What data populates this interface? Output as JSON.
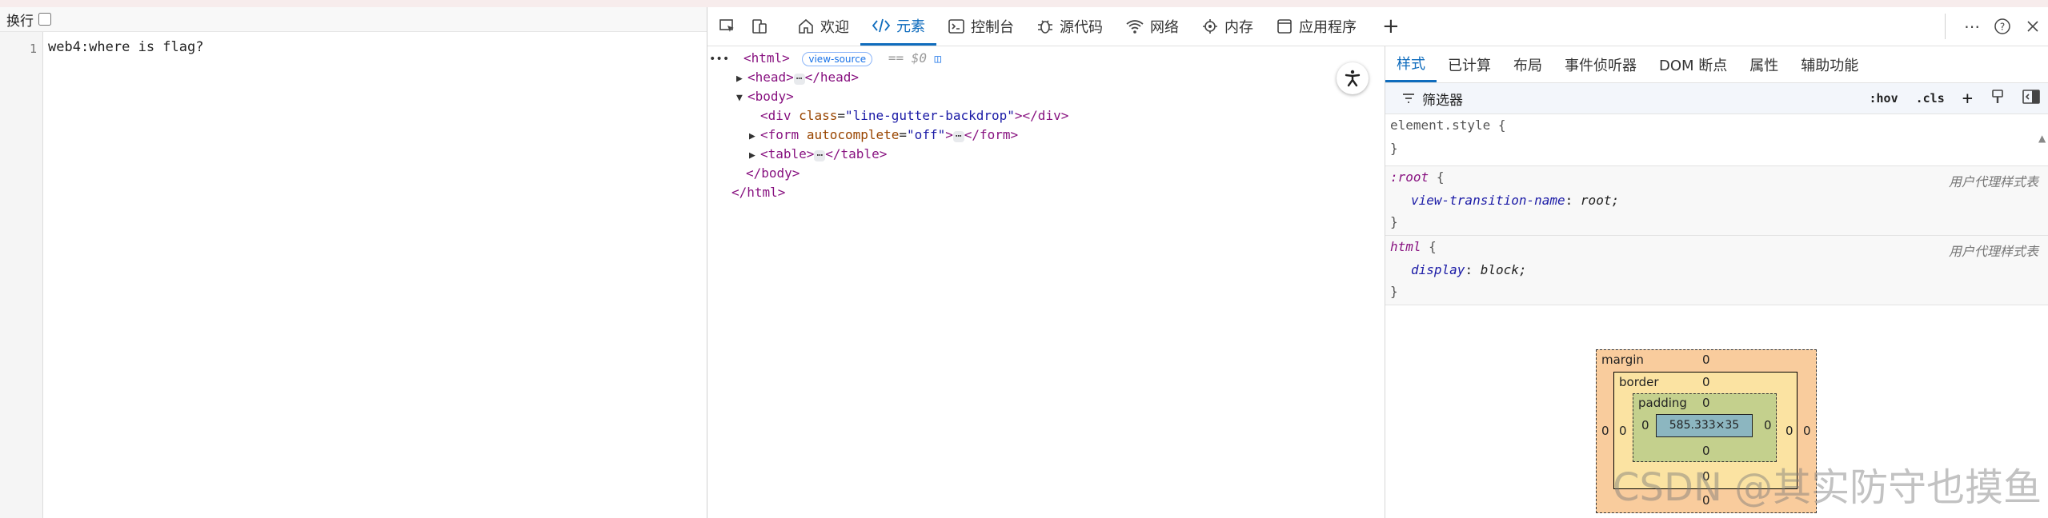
{
  "source": {
    "wrap_label": "换行",
    "line_number": "1",
    "line_text": "web4:where is flag?"
  },
  "devtools": {
    "tabs": [
      {
        "label": "欢迎",
        "icon": "home-icon"
      },
      {
        "label": "元素",
        "icon": "code-tags-icon"
      },
      {
        "label": "控制台",
        "icon": "console-icon"
      },
      {
        "label": "源代码",
        "icon": "bug-icon"
      },
      {
        "label": "网络",
        "icon": "wifi-icon"
      },
      {
        "label": "内存",
        "icon": "memory-icon"
      },
      {
        "label": "应用程序",
        "icon": "app-window-icon"
      }
    ],
    "active_tab": "元素",
    "add_tab_symbol": "+"
  },
  "dom": {
    "html_open": "<html>",
    "view_source_badge": "view-source",
    "dollar0": "== $0",
    "head_open": "<head>",
    "head_close": "</head>",
    "body_open": "<body>",
    "div_open_tag": "<div",
    "div_attr_name": "class",
    "div_attr_value": "\"line-gutter-backdrop\"",
    "div_close": "></div>",
    "form_open_tag": "<form",
    "form_attr_name": "autocomplete",
    "form_attr_value": "\"off\"",
    "form_gt": ">",
    "form_close": "</form>",
    "table_open": "<table>",
    "table_close": "</table>",
    "body_close": "</body>",
    "html_close": "</html>",
    "ellipsis": "⋯"
  },
  "styles": {
    "subtabs": [
      "样式",
      "已计算",
      "布局",
      "事件侦听器",
      "DOM 断点",
      "属性",
      "辅助功能"
    ],
    "active_subtab": "样式",
    "filter_label": "筛选器",
    "hov": ":hov",
    "cls": ".cls",
    "rules": {
      "element_style": "element.style {",
      "root_selector": ":root",
      "root_prop": "view-transition-name",
      "root_value": "root;",
      "root_source": "用户代理样式表",
      "html_selector": "html",
      "html_prop": "display",
      "html_value": "block;",
      "html_source": "用户代理样式表",
      "open_brace": "{",
      "close_brace": "}"
    }
  },
  "box_model": {
    "margin_label": "margin",
    "border_label": "border",
    "padding_label": "padding",
    "margin_top": "0",
    "margin_left": "0",
    "margin_right": "0",
    "margin_bottom": "0",
    "border_top": "0",
    "border_left": "0",
    "border_right": "0",
    "border_bottom": "0",
    "padding_top": "0",
    "padding_left": "0",
    "padding_right": "0",
    "padding_bottom": "0",
    "content": "585.333×35"
  },
  "watermark": "CSDN @其实防守也摸鱼",
  "colors": {
    "accent": "#0f6cbd",
    "margin": "#f9cc9d",
    "border": "#fbe3a2",
    "padding": "#c4d08d",
    "content": "#8cb6c0"
  }
}
